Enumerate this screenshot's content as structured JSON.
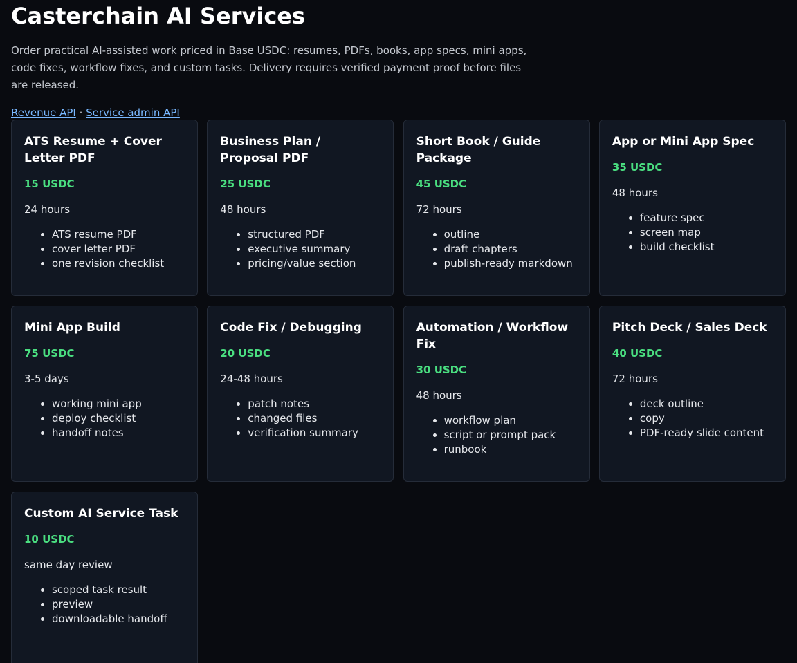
{
  "page": {
    "title": "Casterchain AI Services",
    "intro": "Order practical AI-assisted work priced in Base USDC: resumes, PDFs, books, app specs, mini apps, code fixes, workflow fixes, and custom tasks. Delivery requires verified payment proof before files are released.",
    "links": {
      "revenue_api": "Revenue API",
      "separator": " · ",
      "service_admin_api": "Service admin API"
    }
  },
  "colors": {
    "background": "#090b10",
    "card_background": "#111722",
    "card_border": "#252c39",
    "price_green": "#4ade80",
    "link_blue": "#79b8ff"
  },
  "services": [
    {
      "title": "ATS Resume + Cover Letter PDF",
      "price": "15 USDC",
      "turnaround": "24 hours",
      "deliverables": [
        "ATS resume PDF",
        "cover letter PDF",
        "one revision checklist"
      ]
    },
    {
      "title": "Business Plan / Proposal PDF",
      "price": "25 USDC",
      "turnaround": "48 hours",
      "deliverables": [
        "structured PDF",
        "executive summary",
        "pricing/value section"
      ]
    },
    {
      "title": "Short Book / Guide Package",
      "price": "45 USDC",
      "turnaround": "72 hours",
      "deliverables": [
        "outline",
        "draft chapters",
        "publish-ready markdown"
      ]
    },
    {
      "title": "App or Mini App Spec",
      "price": "35 USDC",
      "turnaround": "48 hours",
      "deliverables": [
        "feature spec",
        "screen map",
        "build checklist"
      ]
    },
    {
      "title": "Mini App Build",
      "price": "75 USDC",
      "turnaround": "3-5 days",
      "deliverables": [
        "working mini app",
        "deploy checklist",
        "handoff notes"
      ]
    },
    {
      "title": "Code Fix / Debugging",
      "price": "20 USDC",
      "turnaround": "24-48 hours",
      "deliverables": [
        "patch notes",
        "changed files",
        "verification summary"
      ]
    },
    {
      "title": "Automation / Workflow Fix",
      "price": "30 USDC",
      "turnaround": "48 hours",
      "deliverables": [
        "workflow plan",
        "script or prompt pack",
        "runbook"
      ]
    },
    {
      "title": "Pitch Deck / Sales Deck",
      "price": "40 USDC",
      "turnaround": "72 hours",
      "deliverables": [
        "deck outline",
        "copy",
        "PDF-ready slide content"
      ]
    },
    {
      "title": "Custom AI Service Task",
      "price": "10 USDC",
      "turnaround": "same day review",
      "deliverables": [
        "scoped task result",
        "preview",
        "downloadable handoff"
      ]
    }
  ]
}
